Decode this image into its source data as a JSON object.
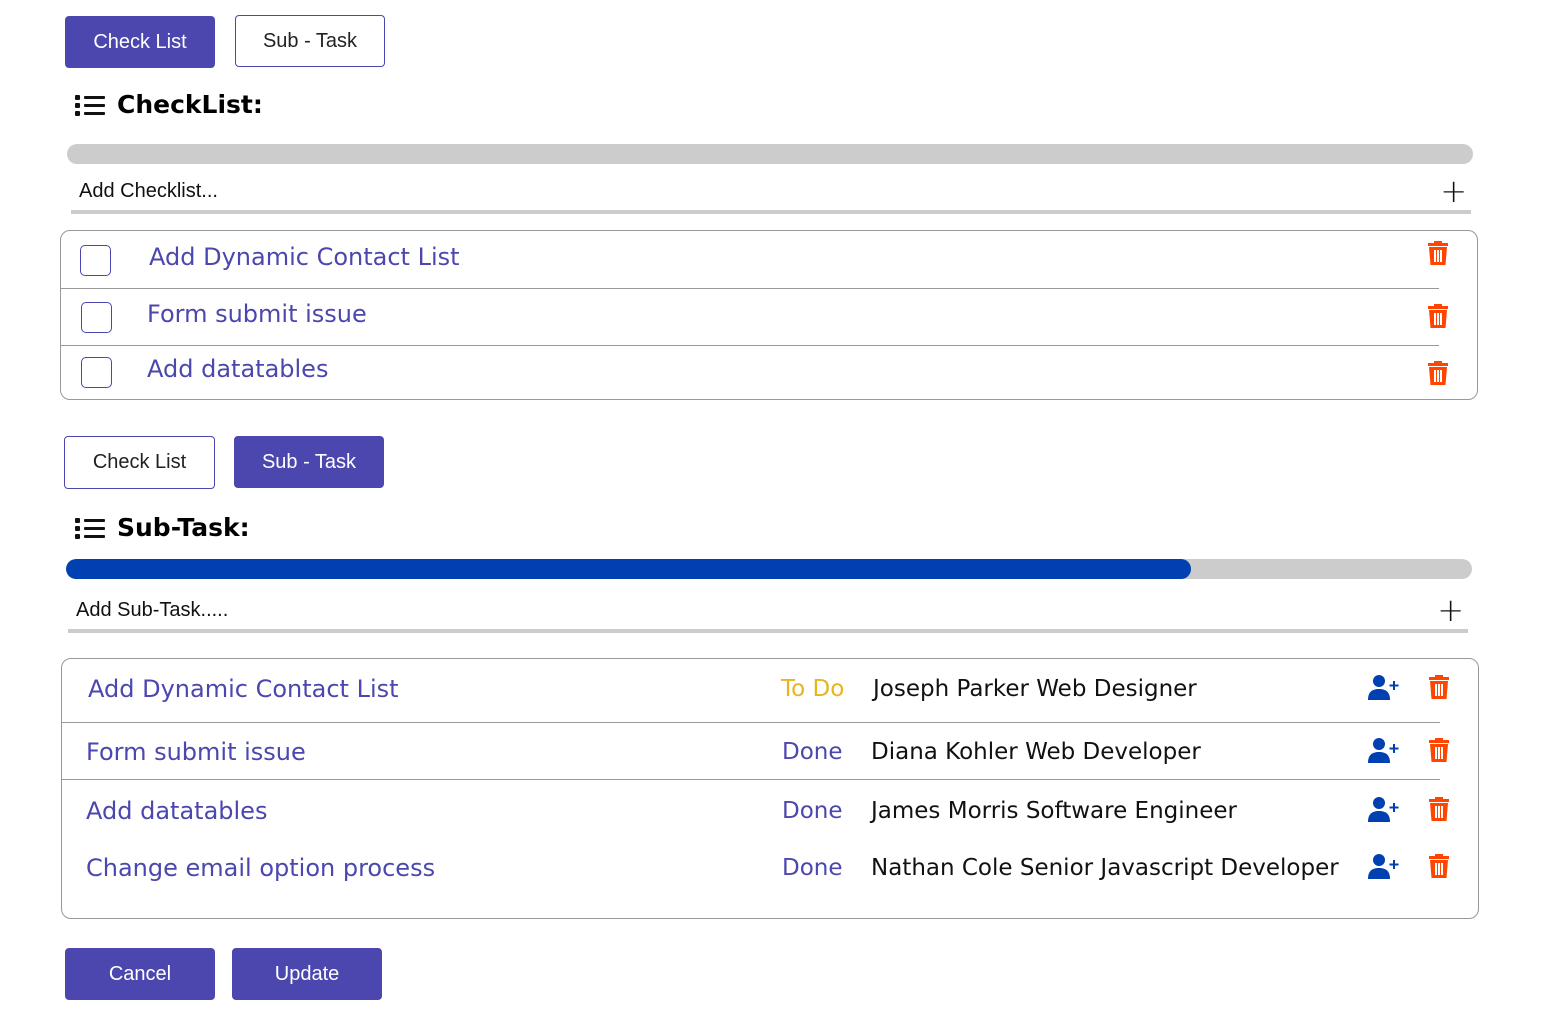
{
  "colors": {
    "primary": "#4b47ae",
    "progress_fill": "#0040b0",
    "progress_track": "#cccccc",
    "todo": "#e8b420",
    "done": "#4b47ae",
    "delete": "#ff4500",
    "assign": "#0040b0"
  },
  "checklist_panel": {
    "tabs": [
      {
        "label": "Check List",
        "active": true
      },
      {
        "label": "Sub - Task",
        "active": false
      }
    ],
    "title": "CheckList:",
    "title_icon": "list-icon",
    "progress": 0,
    "add_input": {
      "placeholder": "Add Checklist...",
      "value": ""
    },
    "add_icon": "plus-icon",
    "items": [
      {
        "text": "Add Dynamic Contact List",
        "checked": false,
        "delete_icon": "trash-icon"
      },
      {
        "text": "Form submit issue",
        "checked": false,
        "delete_icon": "trash-icon"
      },
      {
        "text": "Add datatables",
        "checked": false,
        "delete_icon": "trash-icon"
      }
    ]
  },
  "subtask_panel": {
    "tabs": [
      {
        "label": "Check List",
        "active": false
      },
      {
        "label": "Sub - Task",
        "active": true
      }
    ],
    "title": "Sub-Task:",
    "title_icon": "list-icon",
    "progress": 80,
    "add_input": {
      "placeholder": "Add Sub-Task.....",
      "value": ""
    },
    "add_icon": "plus-icon",
    "items": [
      {
        "text": "Add Dynamic Contact List",
        "status": "To Do",
        "assignee": "Joseph Parker Web Designer"
      },
      {
        "text": "Form submit issue",
        "status": "Done",
        "assignee": "Diana Kohler Web Developer"
      },
      {
        "text": "Add datatables",
        "status": "Done",
        "assignee": "James Morris Software Engineer"
      },
      {
        "text": "Change email option process",
        "status": "Done",
        "assignee": "Nathan Cole Senior Javascript Developer"
      }
    ]
  },
  "footer": {
    "cancel_label": "Cancel",
    "update_label": "Update"
  }
}
